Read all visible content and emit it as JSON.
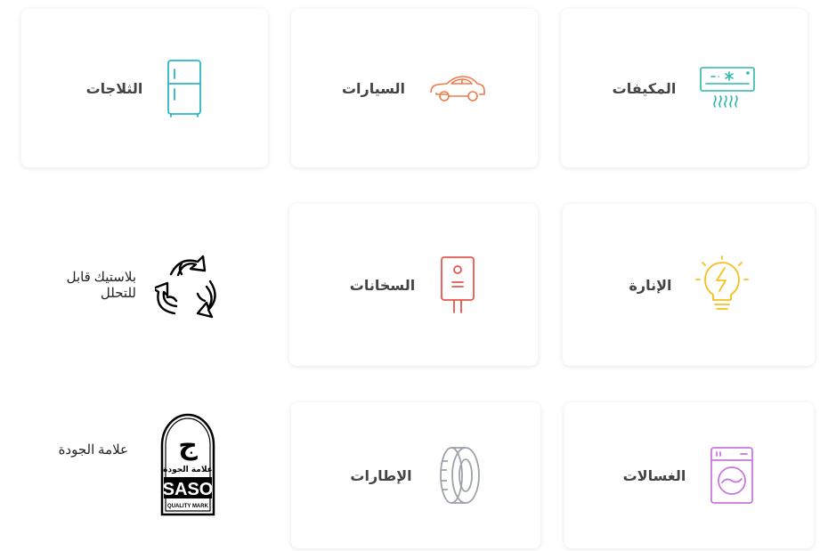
{
  "categories": [
    {
      "label": "المكيفات",
      "icon": "air-conditioner-icon",
      "color": "#2bb9a8"
    },
    {
      "label": "السيارات",
      "icon": "car-icon",
      "color": "#f07a4a"
    },
    {
      "label": "الثلاجات",
      "icon": "refrigerator-icon",
      "color": "#2bb5c8"
    },
    {
      "label": "الإنارة",
      "icon": "light-bulb-icon",
      "color": "#f5c01e"
    },
    {
      "label": "السخانات",
      "icon": "water-heater-icon",
      "color": "#e8554f"
    },
    {
      "label": "الغسالات",
      "icon": "washing-machine-icon",
      "color": "#c878de"
    },
    {
      "label": "الإطارات",
      "icon": "tire-icon",
      "color": "#9ea3aa"
    }
  ],
  "badges": {
    "recycle": {
      "label_line1": "بلاستيك قابل",
      "label_line2": "للتحلل",
      "icon": "recycle-icon"
    },
    "quality": {
      "label": "علامة الجودة",
      "icon": "saso-quality-mark-icon",
      "mark_letter": "ج",
      "mark_arabic": "علامة الجودة",
      "mark_latin": "SASO",
      "mark_sub": "QUALITY MARK"
    }
  }
}
